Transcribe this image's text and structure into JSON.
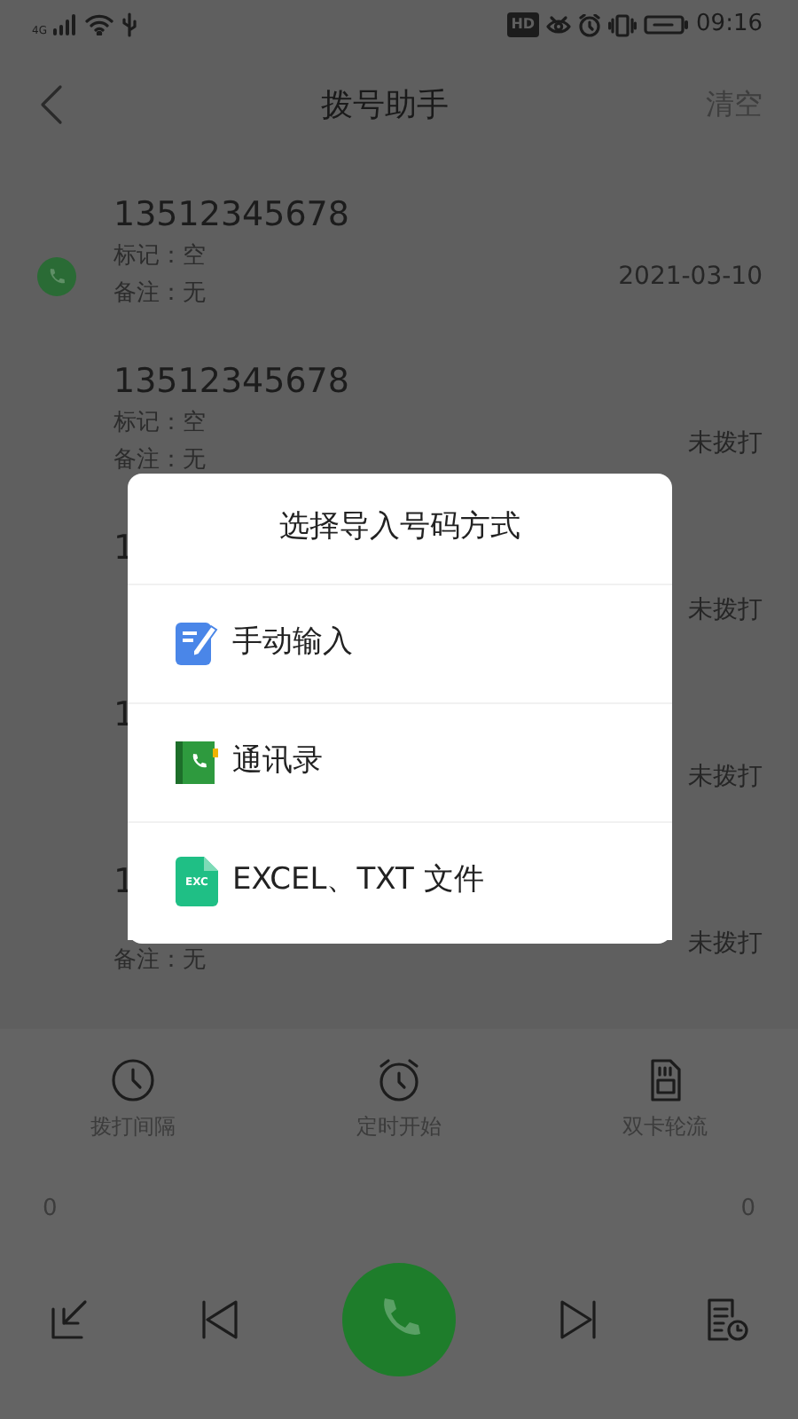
{
  "status_bar": {
    "network": "4G",
    "hd": "HD",
    "time": "09:16"
  },
  "header": {
    "title": "拨号助手",
    "action": "清空"
  },
  "numbers": [
    {
      "number": "13512345678",
      "mark": "标记：空",
      "note": "备注：无",
      "status": "2021-03-10",
      "called": true
    },
    {
      "number": "13512345678",
      "mark": "标记：空",
      "note": "备注：无",
      "status": "未拨打",
      "called": false
    },
    {
      "number": "1",
      "status": "未拨打",
      "called": false
    },
    {
      "number": "1",
      "status": "未拨打",
      "called": false
    },
    {
      "number": "1",
      "note": "备注：无",
      "status": "未拨打",
      "called": false
    }
  ],
  "dialog": {
    "title": "选择导入号码方式",
    "options": [
      {
        "kind": "manual",
        "label": "手动输入"
      },
      {
        "kind": "contacts",
        "label": "通讯录"
      },
      {
        "kind": "file",
        "label": "EXCEL、TXT 文件",
        "icon_text": "EXC"
      }
    ]
  },
  "settings": [
    {
      "kind": "interval",
      "label": "拨打间隔"
    },
    {
      "kind": "timer",
      "label": "定时开始"
    },
    {
      "kind": "dual_sim",
      "label": "双卡轮流"
    }
  ],
  "counts": [
    "0",
    "0"
  ],
  "controls": [
    {
      "kind": "import"
    },
    {
      "kind": "previous"
    },
    {
      "kind": "call"
    },
    {
      "kind": "next"
    },
    {
      "kind": "log"
    }
  ]
}
